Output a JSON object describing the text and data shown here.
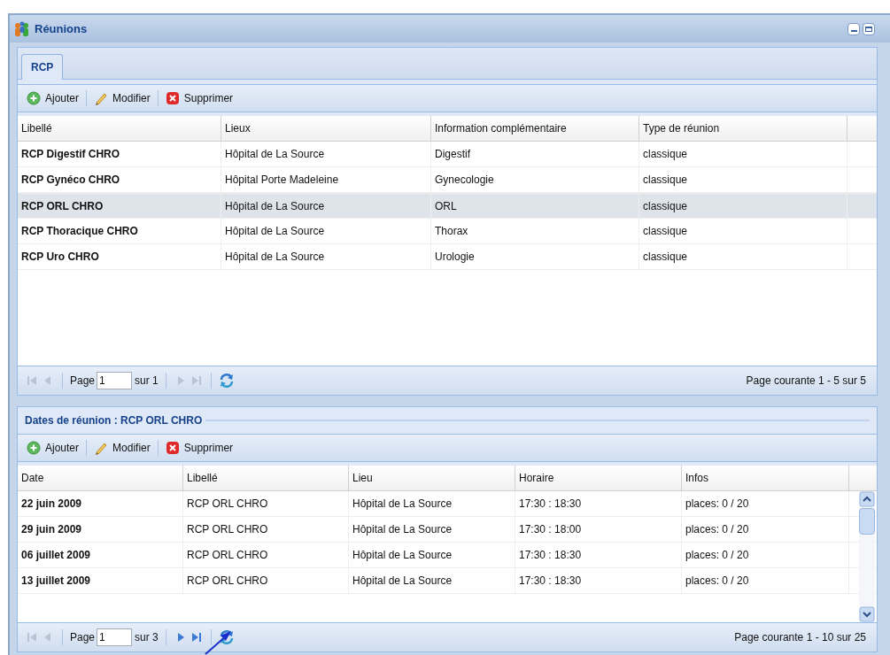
{
  "window": {
    "title": "Réunions"
  },
  "tabs": [
    {
      "label": "RCP",
      "selected": true
    }
  ],
  "toolbar": [
    {
      "kind": "add",
      "label": "Ajouter"
    },
    {
      "kind": "edit",
      "label": "Modifier"
    },
    {
      "kind": "delete",
      "label": "Supprimer"
    }
  ],
  "grid": {
    "columns": [
      "Libellé",
      "Lieux",
      "Information complémentaire",
      "Type de réunion"
    ],
    "rows": [
      {
        "cells": [
          "RCP Digestif CHRO",
          "Hôpital de La Source",
          "Digestif",
          "classique"
        ],
        "selected": false
      },
      {
        "cells": [
          "RCP Gynéco CHRO",
          "Hôpital Porte Madeleine",
          "Gynecologie",
          "classique"
        ],
        "selected": false
      },
      {
        "cells": [
          "RCP ORL CHRO",
          "Hôpital de La Source",
          "ORL",
          "classique"
        ],
        "selected": true
      },
      {
        "cells": [
          "RCP Thoracique CHRO",
          "Hôpital de La Source",
          "Thorax",
          "classique"
        ],
        "selected": false
      },
      {
        "cells": [
          "RCP Uro CHRO",
          "Hôpital de La Source",
          "Urologie",
          "classique"
        ],
        "selected": false
      }
    ],
    "pager": {
      "page_label": "Page",
      "page": "1",
      "of": "sur 1",
      "nav": [
        {
          "kind": "first",
          "disabled": true
        },
        {
          "kind": "prev",
          "disabled": true
        },
        {
          "kind": "next",
          "disabled": true
        },
        {
          "kind": "last",
          "disabled": true
        }
      ],
      "status": "Page courante 1 - 5 sur 5"
    }
  },
  "dates_panel": {
    "title": "Dates de réunion : RCP ORL CHRO",
    "toolbar": [
      {
        "kind": "add",
        "label": "Ajouter"
      },
      {
        "kind": "edit",
        "label": "Modifier"
      },
      {
        "kind": "delete",
        "label": "Supprimer"
      }
    ],
    "columns": [
      "Date",
      "Libellé",
      "Lieu",
      "Horaire",
      "Infos"
    ],
    "rows": [
      {
        "cells": [
          "22 juin 2009",
          "RCP ORL CHRO",
          "Hôpital de La Source",
          "17:30 : 18:30",
          "places: 0 / 20"
        ]
      },
      {
        "cells": [
          "29 juin 2009",
          "RCP ORL CHRO",
          "Hôpital de La Source",
          "17:30 : 18:00",
          "places: 0 / 20"
        ]
      },
      {
        "cells": [
          "06 juillet 2009",
          "RCP ORL CHRO",
          "Hôpital de La Source",
          "17:30 : 18:30",
          "places: 0 / 20"
        ]
      },
      {
        "cells": [
          "13 juillet 2009",
          "RCP ORL CHRO",
          "Hôpital de La Source",
          "17:30 : 18:30",
          "places: 0 / 20"
        ]
      }
    ],
    "pager": {
      "page_label": "Page",
      "page": "1",
      "of": "sur 3",
      "nav": [
        {
          "kind": "first",
          "disabled": true
        },
        {
          "kind": "prev",
          "disabled": true
        },
        {
          "kind": "next",
          "disabled": false
        },
        {
          "kind": "last",
          "disabled": false
        }
      ],
      "status": "Page courante 1 - 10 sur 25"
    }
  }
}
